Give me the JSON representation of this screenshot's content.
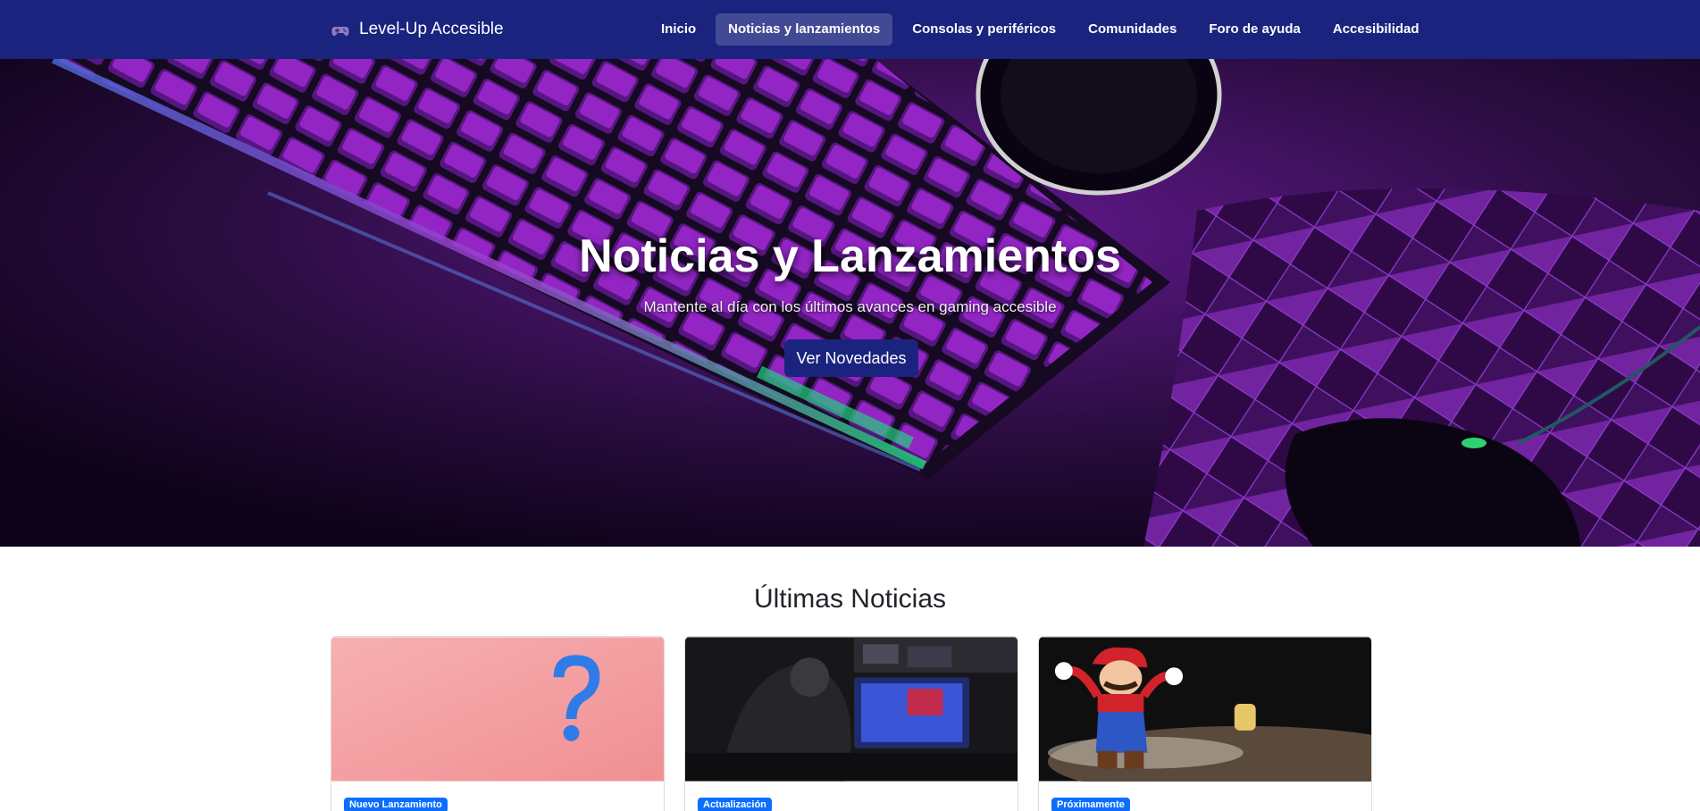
{
  "brand": {
    "name": "Level-Up Accesible",
    "icon": "gamepad-icon"
  },
  "nav": {
    "items": [
      {
        "label": "Inicio"
      },
      {
        "label": "Noticias y lanzamientos",
        "active": true
      },
      {
        "label": "Consolas y periféricos"
      },
      {
        "label": "Comunidades"
      },
      {
        "label": "Foro de ayuda"
      },
      {
        "label": "Accesibilidad"
      }
    ]
  },
  "hero": {
    "title": "Noticias y Lanzamientos",
    "subtitle": "Mantente al día con los últimos avances en gaming accesible",
    "button_label": "Ver Novedades"
  },
  "news": {
    "title": "Últimas Noticias",
    "cards": [
      {
        "badge": "Nuevo Lanzamiento",
        "image": "question-mark-image"
      },
      {
        "badge": "Actualización",
        "image": "esports-player-image"
      },
      {
        "badge": "Próximamente",
        "image": "mario-figure-image"
      }
    ]
  },
  "colors": {
    "navbar": "#1a237e",
    "badge": "#0d6efd",
    "hero_accent": "#b026ff"
  }
}
